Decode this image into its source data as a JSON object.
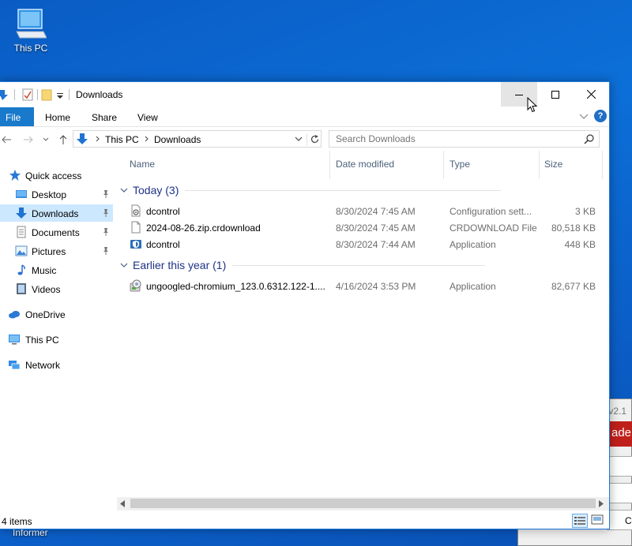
{
  "desktop": {
    "this_pc_label": "This PC",
    "taskbar_label": "Informer"
  },
  "background_window": {
    "version": "v2.1",
    "red_button": "ader",
    "box_text": "C"
  },
  "window": {
    "title": "Downloads",
    "ribbon": {
      "file": "File",
      "home": "Home",
      "share": "Share",
      "view": "View",
      "help": "?"
    },
    "address": {
      "crumbs": [
        "This PC",
        "Downloads"
      ]
    },
    "search": {
      "placeholder": "Search Downloads"
    },
    "nav": {
      "quick_access": "Quick access",
      "desktop": "Desktop",
      "downloads": "Downloads",
      "documents": "Documents",
      "pictures": "Pictures",
      "music": "Music",
      "videos": "Videos",
      "onedrive": "OneDrive",
      "this_pc": "This PC",
      "network": "Network"
    },
    "columns": {
      "name": "Name",
      "date": "Date modified",
      "type": "Type",
      "size": "Size"
    },
    "groups": [
      {
        "title": "Today (3)",
        "files": [
          {
            "name": "dcontrol",
            "date": "8/30/2024 7:45 AM",
            "type": "Configuration sett...",
            "size": "3 KB",
            "icon": "config-file-icon"
          },
          {
            "name": "2024-08-26.zip.crdownload",
            "date": "8/30/2024 7:45 AM",
            "type": "CRDOWNLOAD File",
            "size": "80,518 KB",
            "icon": "blank-file-icon"
          },
          {
            "name": "dcontrol",
            "date": "8/30/2024 7:44 AM",
            "type": "Application",
            "size": "448 KB",
            "icon": "shield-app-icon"
          }
        ]
      },
      {
        "title": "Earlier this year (1)",
        "files": [
          {
            "name": "ungoogled-chromium_123.0.6312.122-1....",
            "date": "4/16/2024 3:53 PM",
            "type": "Application",
            "size": "82,677 KB",
            "icon": "installer-icon"
          }
        ]
      }
    ],
    "status": {
      "count": "4 items"
    }
  },
  "colors": {
    "accent": "#1979ca",
    "selected": "#cce8ff",
    "group_title": "#1e3287",
    "desktop": "#0c6fd8"
  }
}
